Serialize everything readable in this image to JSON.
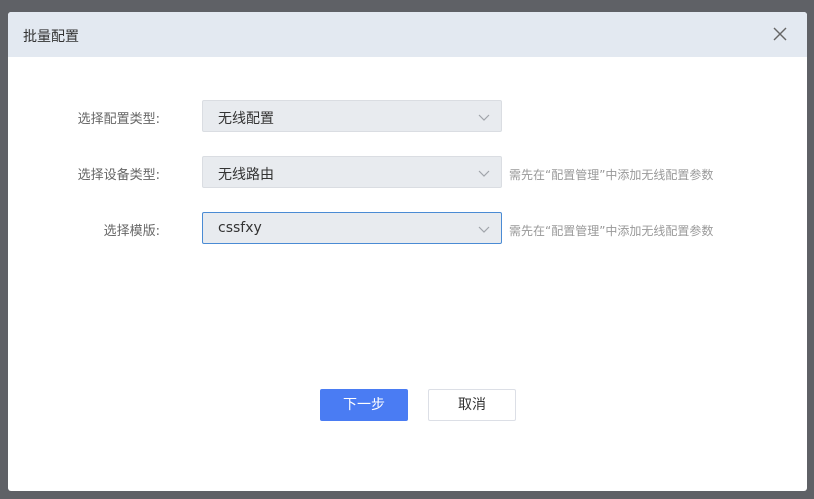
{
  "dialog": {
    "title": "批量配置",
    "fields": [
      {
        "label": "选择配置类型:",
        "value": "无线配置",
        "hint": ""
      },
      {
        "label": "选择设备类型:",
        "value": "无线路由",
        "hint": "需先在“配置管理”中添加无线配置参数"
      },
      {
        "label": "选择模版:",
        "value": "cssfxy",
        "hint": "需先在“配置管理”中添加无线配置参数"
      }
    ],
    "next_label": "下一步",
    "cancel_label": "取消"
  }
}
